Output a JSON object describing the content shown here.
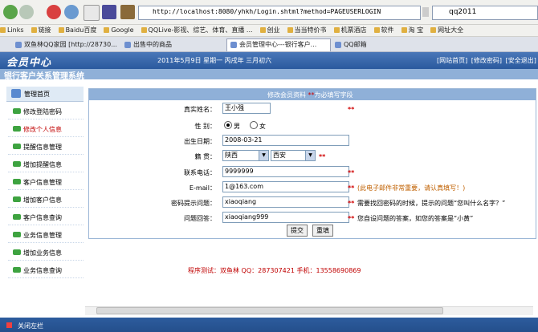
{
  "browser": {
    "address": "http://localhost:8080/yhkh/Login.shtml?method=PAGEUSERLOGIN",
    "search_value": "qq2011",
    "links": [
      "Links",
      "链接",
      "Baidu百度",
      "Google",
      "QQLive-影视、综艺、体育、直播 ...",
      "创业",
      "当当特价书",
      "机票酒店",
      "软件",
      "淘 宝",
      "网址大全"
    ],
    "tabs": [
      "双鱼林QQ家园 [http://28730...",
      "出售中的商品",
      "会员管理中心---银行客户...",
      "QQ邮箱"
    ]
  },
  "header": {
    "brand": "会员中心",
    "date": "2011年5月9日  星期一  丙戌年 三月初六",
    "links": [
      "[网站首页]",
      "[修改密码]",
      "[安全退出]"
    ]
  },
  "system_title": "银行客户关系管理系统",
  "sidebar": {
    "head": "管理首页",
    "items": [
      {
        "label": "修改登陆密码",
        "active": false
      },
      {
        "label": "修改个人信息",
        "active": true
      },
      {
        "label": "提醒信息管理",
        "active": false
      },
      {
        "label": "增加提醒信息",
        "active": false
      },
      {
        "label": "客户信息管理",
        "active": false
      },
      {
        "label": "增加客户信息",
        "active": false
      },
      {
        "label": "客户信息查询",
        "active": false
      },
      {
        "label": "业务信息管理",
        "active": false
      },
      {
        "label": "增加业务信息",
        "active": false
      },
      {
        "label": "业务信息查询",
        "active": false
      }
    ]
  },
  "form": {
    "title_prefix": "修改会员资料 ",
    "title_star": "**",
    "title_suffix": "为必填写字段",
    "name_label": "真实姓名：",
    "name_value": "王小强",
    "gender_label": "性    别：",
    "gender_male": "男",
    "gender_female": "女",
    "gender_value": "男",
    "birth_label": "出生日期：",
    "birth_value": "2008-03-21",
    "origin_label": "籍    贯：",
    "province": "陕西",
    "city": "西安",
    "phone_label": "联系电话：",
    "phone_value": "9999999",
    "email_label": "E-mail：",
    "email_value": "1@163.com",
    "email_hint": "(此电子邮件非常重要，请认真填写！)",
    "question_label": "密码提示问题：",
    "question_value": "xiaoqiang",
    "question_hint": "需要找回密码的时候，提示的问题“您叫什么名字？”",
    "answer_label": "问题回答：",
    "answer_value": "xiaoqiang999",
    "answer_hint": "您自设问题的答案，如您的答案是“小黄”",
    "required_mark": "**",
    "submit": "提交",
    "reset": "重填"
  },
  "footer_note": "程序测试：双鱼林  QQ：287307421  手机：13558690869",
  "bottom_label": "关闭左栏",
  "colors": {
    "header_blue": "#2a5a9e",
    "band_blue": "#8fb0d8",
    "required_red": "#d00000",
    "hint_orange": "#c06000"
  }
}
